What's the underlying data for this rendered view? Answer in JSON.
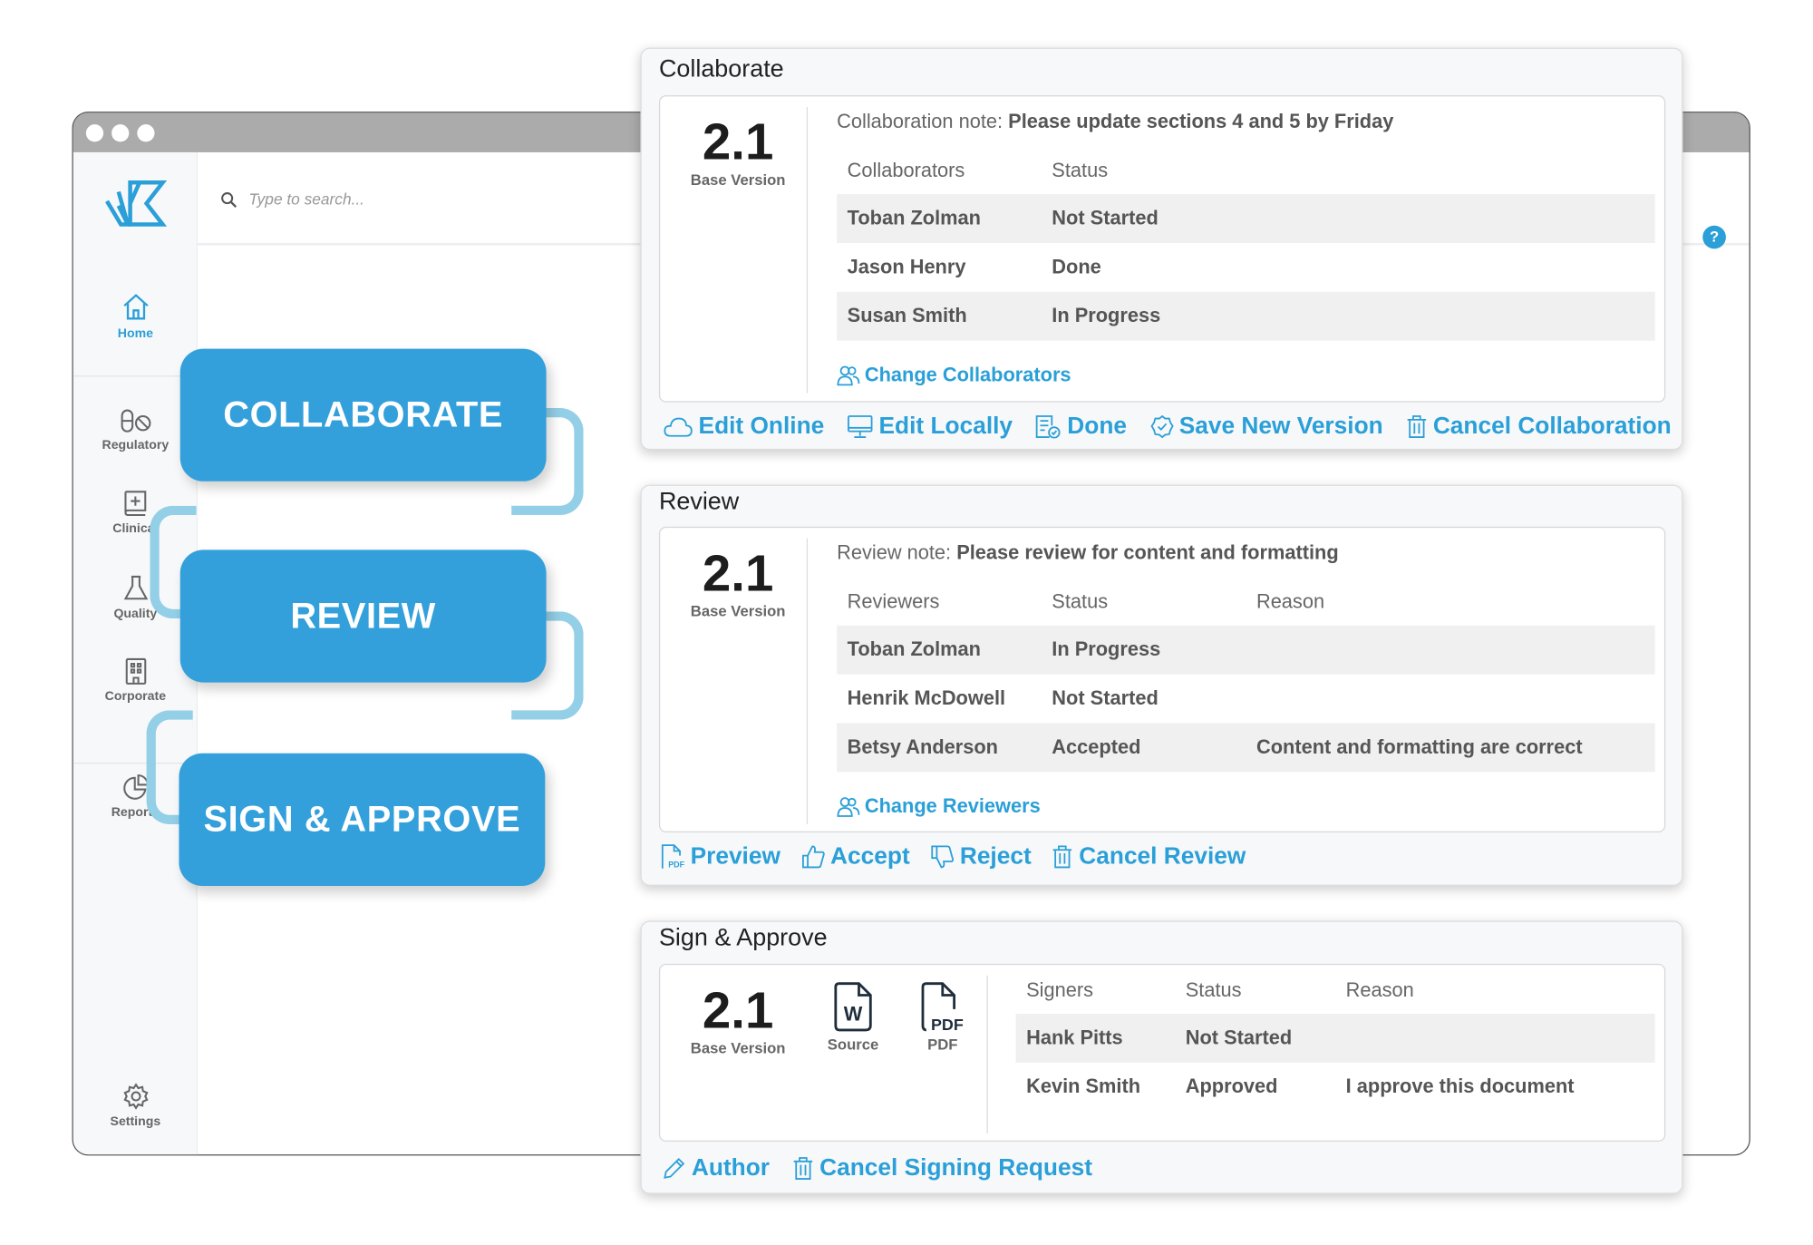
{
  "window": {
    "search_placeholder": "Type to search...",
    "help": "?"
  },
  "sidebar": {
    "items": [
      {
        "label": "Home",
        "icon": "home-icon",
        "active": true
      },
      {
        "label": "Regulatory",
        "icon": "pills-icon"
      },
      {
        "label": "Clinical",
        "icon": "medical-book-icon"
      },
      {
        "label": "Quality",
        "icon": "flask-icon"
      },
      {
        "label": "Corporate",
        "icon": "building-icon"
      },
      {
        "label": "Reports",
        "icon": "pie-chart-icon"
      },
      {
        "label": "Settings",
        "icon": "gear-icon"
      }
    ]
  },
  "steps": [
    "COLLABORATE",
    "REVIEW",
    "SIGN & APPROVE"
  ],
  "colors": {
    "accent": "#2a9fd8",
    "step_button": "#33a0db",
    "connector": "#93cfe6"
  },
  "collaborate": {
    "title": "Collaborate",
    "version": "2.1",
    "version_label": "Base Version",
    "note_label": "Collaboration note:",
    "note": "Please update sections 4 and 5 by Friday",
    "headers": [
      "Collaborators",
      "Status"
    ],
    "rows": [
      [
        "Toban Zolman",
        "Not Started"
      ],
      [
        "Jason Henry",
        "Done"
      ],
      [
        "Susan Smith",
        "In Progress"
      ]
    ],
    "change_link": "Change Collaborators",
    "actions": [
      "Edit Online",
      "Edit Locally",
      "Done",
      "Save New Version",
      "Cancel Collaboration"
    ]
  },
  "review": {
    "title": "Review",
    "version": "2.1",
    "version_label": "Base Version",
    "note_label": "Review note:",
    "note": "Please review for content and formatting",
    "headers": [
      "Reviewers",
      "Status",
      "Reason"
    ],
    "rows": [
      [
        "Toban Zolman",
        "In Progress",
        ""
      ],
      [
        "Henrik McDowell",
        "Not Started",
        ""
      ],
      [
        "Betsy Anderson",
        "Accepted",
        "Content and formatting are correct"
      ]
    ],
    "change_link": "Change Reviewers",
    "actions": [
      "Preview",
      "Accept",
      "Reject",
      "Cancel Review"
    ]
  },
  "sign": {
    "title": "Sign & Approve",
    "version": "2.1",
    "version_label": "Base Version",
    "source_label": "Source",
    "pdf_label": "PDF",
    "headers": [
      "Signers",
      "Status",
      "Reason"
    ],
    "rows": [
      [
        "Hank Pitts",
        "Not Started",
        ""
      ],
      [
        "Kevin Smith",
        "Approved",
        "I approve this document"
      ]
    ],
    "actions": [
      "Author",
      "Cancel Signing Request"
    ]
  }
}
